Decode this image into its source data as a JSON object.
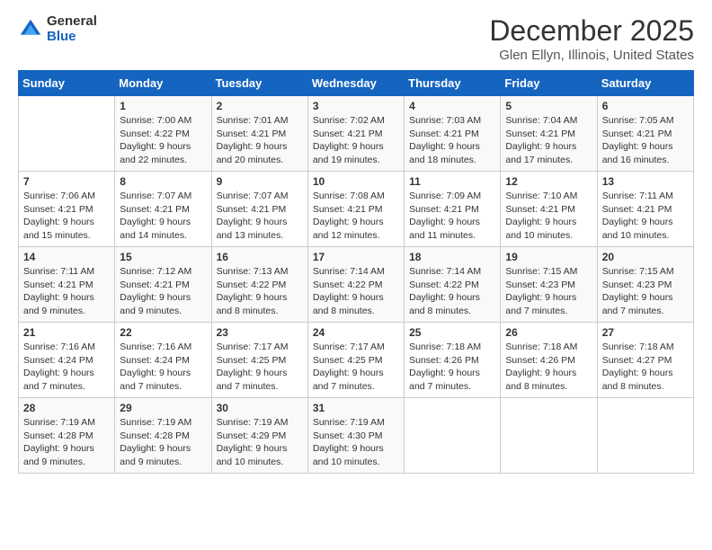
{
  "header": {
    "logo_general": "General",
    "logo_blue": "Blue",
    "month": "December 2025",
    "location": "Glen Ellyn, Illinois, United States"
  },
  "days_of_week": [
    "Sunday",
    "Monday",
    "Tuesday",
    "Wednesday",
    "Thursday",
    "Friday",
    "Saturday"
  ],
  "weeks": [
    [
      {
        "num": "",
        "info": ""
      },
      {
        "num": "1",
        "info": "Sunrise: 7:00 AM\nSunset: 4:22 PM\nDaylight: 9 hours\nand 22 minutes."
      },
      {
        "num": "2",
        "info": "Sunrise: 7:01 AM\nSunset: 4:21 PM\nDaylight: 9 hours\nand 20 minutes."
      },
      {
        "num": "3",
        "info": "Sunrise: 7:02 AM\nSunset: 4:21 PM\nDaylight: 9 hours\nand 19 minutes."
      },
      {
        "num": "4",
        "info": "Sunrise: 7:03 AM\nSunset: 4:21 PM\nDaylight: 9 hours\nand 18 minutes."
      },
      {
        "num": "5",
        "info": "Sunrise: 7:04 AM\nSunset: 4:21 PM\nDaylight: 9 hours\nand 17 minutes."
      },
      {
        "num": "6",
        "info": "Sunrise: 7:05 AM\nSunset: 4:21 PM\nDaylight: 9 hours\nand 16 minutes."
      }
    ],
    [
      {
        "num": "7",
        "info": "Sunrise: 7:06 AM\nSunset: 4:21 PM\nDaylight: 9 hours\nand 15 minutes."
      },
      {
        "num": "8",
        "info": "Sunrise: 7:07 AM\nSunset: 4:21 PM\nDaylight: 9 hours\nand 14 minutes."
      },
      {
        "num": "9",
        "info": "Sunrise: 7:07 AM\nSunset: 4:21 PM\nDaylight: 9 hours\nand 13 minutes."
      },
      {
        "num": "10",
        "info": "Sunrise: 7:08 AM\nSunset: 4:21 PM\nDaylight: 9 hours\nand 12 minutes."
      },
      {
        "num": "11",
        "info": "Sunrise: 7:09 AM\nSunset: 4:21 PM\nDaylight: 9 hours\nand 11 minutes."
      },
      {
        "num": "12",
        "info": "Sunrise: 7:10 AM\nSunset: 4:21 PM\nDaylight: 9 hours\nand 10 minutes."
      },
      {
        "num": "13",
        "info": "Sunrise: 7:11 AM\nSunset: 4:21 PM\nDaylight: 9 hours\nand 10 minutes."
      }
    ],
    [
      {
        "num": "14",
        "info": "Sunrise: 7:11 AM\nSunset: 4:21 PM\nDaylight: 9 hours\nand 9 minutes."
      },
      {
        "num": "15",
        "info": "Sunrise: 7:12 AM\nSunset: 4:21 PM\nDaylight: 9 hours\nand 9 minutes."
      },
      {
        "num": "16",
        "info": "Sunrise: 7:13 AM\nSunset: 4:22 PM\nDaylight: 9 hours\nand 8 minutes."
      },
      {
        "num": "17",
        "info": "Sunrise: 7:14 AM\nSunset: 4:22 PM\nDaylight: 9 hours\nand 8 minutes."
      },
      {
        "num": "18",
        "info": "Sunrise: 7:14 AM\nSunset: 4:22 PM\nDaylight: 9 hours\nand 8 minutes."
      },
      {
        "num": "19",
        "info": "Sunrise: 7:15 AM\nSunset: 4:23 PM\nDaylight: 9 hours\nand 7 minutes."
      },
      {
        "num": "20",
        "info": "Sunrise: 7:15 AM\nSunset: 4:23 PM\nDaylight: 9 hours\nand 7 minutes."
      }
    ],
    [
      {
        "num": "21",
        "info": "Sunrise: 7:16 AM\nSunset: 4:24 PM\nDaylight: 9 hours\nand 7 minutes."
      },
      {
        "num": "22",
        "info": "Sunrise: 7:16 AM\nSunset: 4:24 PM\nDaylight: 9 hours\nand 7 minutes."
      },
      {
        "num": "23",
        "info": "Sunrise: 7:17 AM\nSunset: 4:25 PM\nDaylight: 9 hours\nand 7 minutes."
      },
      {
        "num": "24",
        "info": "Sunrise: 7:17 AM\nSunset: 4:25 PM\nDaylight: 9 hours\nand 7 minutes."
      },
      {
        "num": "25",
        "info": "Sunrise: 7:18 AM\nSunset: 4:26 PM\nDaylight: 9 hours\nand 7 minutes."
      },
      {
        "num": "26",
        "info": "Sunrise: 7:18 AM\nSunset: 4:26 PM\nDaylight: 9 hours\nand 8 minutes."
      },
      {
        "num": "27",
        "info": "Sunrise: 7:18 AM\nSunset: 4:27 PM\nDaylight: 9 hours\nand 8 minutes."
      }
    ],
    [
      {
        "num": "28",
        "info": "Sunrise: 7:19 AM\nSunset: 4:28 PM\nDaylight: 9 hours\nand 9 minutes."
      },
      {
        "num": "29",
        "info": "Sunrise: 7:19 AM\nSunset: 4:28 PM\nDaylight: 9 hours\nand 9 minutes."
      },
      {
        "num": "30",
        "info": "Sunrise: 7:19 AM\nSunset: 4:29 PM\nDaylight: 9 hours\nand 10 minutes."
      },
      {
        "num": "31",
        "info": "Sunrise: 7:19 AM\nSunset: 4:30 PM\nDaylight: 9 hours\nand 10 minutes."
      },
      {
        "num": "",
        "info": ""
      },
      {
        "num": "",
        "info": ""
      },
      {
        "num": "",
        "info": ""
      }
    ]
  ]
}
